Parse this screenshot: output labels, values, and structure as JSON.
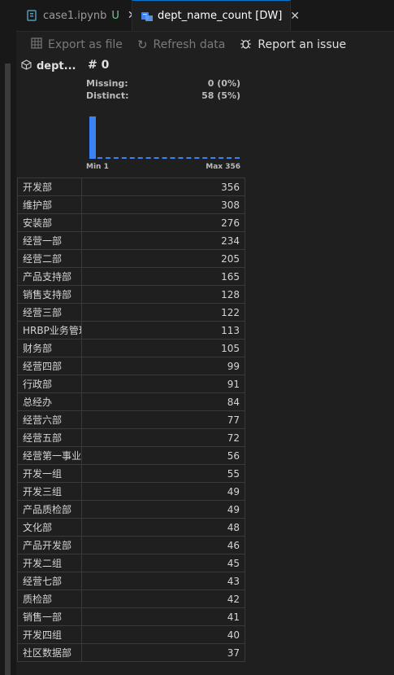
{
  "tabs": [
    {
      "label": "case1.ipynb",
      "status": "U"
    },
    {
      "label": "dept_name_count [DW]",
      "close": "✕"
    }
  ],
  "toolbar": {
    "export_label": "Export as file",
    "refresh_label": "Refresh data",
    "report_label": "Report an issue"
  },
  "column": {
    "name": "dept...",
    "type": "# 0",
    "missing_label": "Missing:",
    "missing_value": "0 (0%)",
    "distinct_label": "Distinct:",
    "distinct_value": "58 (5%)",
    "min_label": "Min 1",
    "max_label": "Max 356"
  },
  "colors": {
    "accent": "#3b82f6",
    "modified": "#73c991",
    "tab_border": "#0078d4"
  },
  "rows": [
    {
      "name": "开发部",
      "count": "356"
    },
    {
      "name": "维护部",
      "count": "308"
    },
    {
      "name": "安装部",
      "count": "276"
    },
    {
      "name": "经营一部",
      "count": "234"
    },
    {
      "name": "经营二部",
      "count": "205"
    },
    {
      "name": "产品支持部",
      "count": "165"
    },
    {
      "name": "销售支持部",
      "count": "128"
    },
    {
      "name": "经营三部",
      "count": "122"
    },
    {
      "name": "HRBP业务管理",
      "count": "113"
    },
    {
      "name": "财务部",
      "count": "105"
    },
    {
      "name": "经营四部",
      "count": "99"
    },
    {
      "name": "行政部",
      "count": "91"
    },
    {
      "name": "总经办",
      "count": "84"
    },
    {
      "name": "经营六部",
      "count": "77"
    },
    {
      "name": "经营五部",
      "count": "72"
    },
    {
      "name": "经营第一事业",
      "count": "56"
    },
    {
      "name": "开发一组",
      "count": "55"
    },
    {
      "name": "开发三组",
      "count": "49"
    },
    {
      "name": "产品质检部",
      "count": "49"
    },
    {
      "name": "文化部",
      "count": "48"
    },
    {
      "name": "产品开发部",
      "count": "46"
    },
    {
      "name": "开发二组",
      "count": "45"
    },
    {
      "name": "经营七部",
      "count": "43"
    },
    {
      "name": "质检部",
      "count": "42"
    },
    {
      "name": "销售一部",
      "count": "41"
    },
    {
      "name": "开发四组",
      "count": "40"
    },
    {
      "name": "社区数据部",
      "count": "37"
    }
  ]
}
